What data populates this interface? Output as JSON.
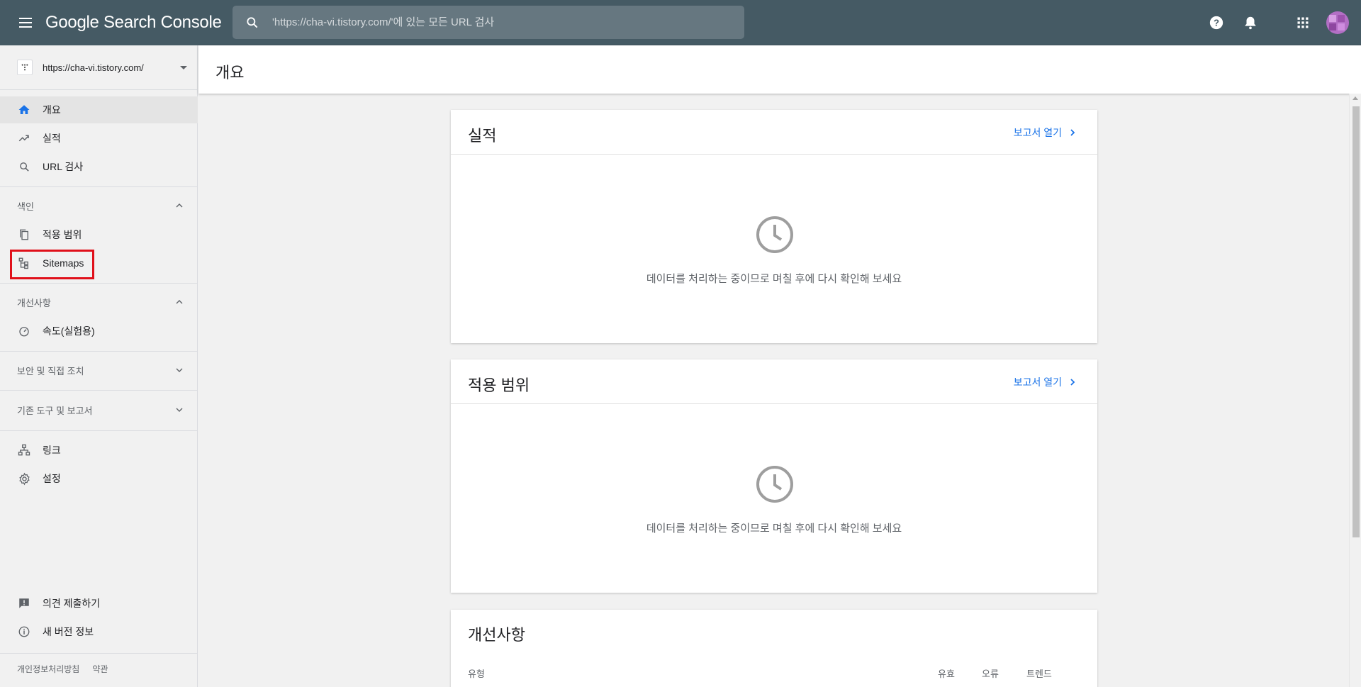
{
  "topbar": {
    "app_name": "Google Search Console",
    "search_placeholder": "'https://cha-vi.tistory.com/'에 있는 모든 URL 검사"
  },
  "sidebar": {
    "property_url": "https://cha-vi.tistory.com/",
    "items": {
      "overview": "개요",
      "performance": "실적",
      "url_inspection": "URL 검사",
      "index_section": "색인",
      "coverage": "적용 범위",
      "sitemaps": "Sitemaps",
      "enhancements_section": "개선사항",
      "speed": "속도(실험용)",
      "security_section": "보안 및 직접 조치",
      "legacy_section": "기존 도구 및 보고서",
      "links": "링크",
      "settings": "설정",
      "feedback": "의견 제출하기",
      "whats_new": "새 버전 정보"
    },
    "footer": {
      "privacy": "개인정보처리방침",
      "terms": "약관"
    }
  },
  "main": {
    "page_title": "개요",
    "cards": [
      {
        "title": "실적",
        "link": "보고서 열기",
        "message": "데이터를 처리하는 중이므로 며칠 후에 다시 확인해 보세요"
      },
      {
        "title": "적용 범위",
        "link": "보고서 열기",
        "message": "데이터를 처리하는 중이므로 며칠 후에 다시 확인해 보세요"
      }
    ],
    "enhancements": {
      "title": "개선사항",
      "columns": {
        "type": "유형",
        "valid": "유효",
        "errors": "오류",
        "trend": "트렌드"
      }
    }
  },
  "colors": {
    "topbar": "#455a64",
    "link": "#1a73e8",
    "highlight": "#e0101a"
  }
}
